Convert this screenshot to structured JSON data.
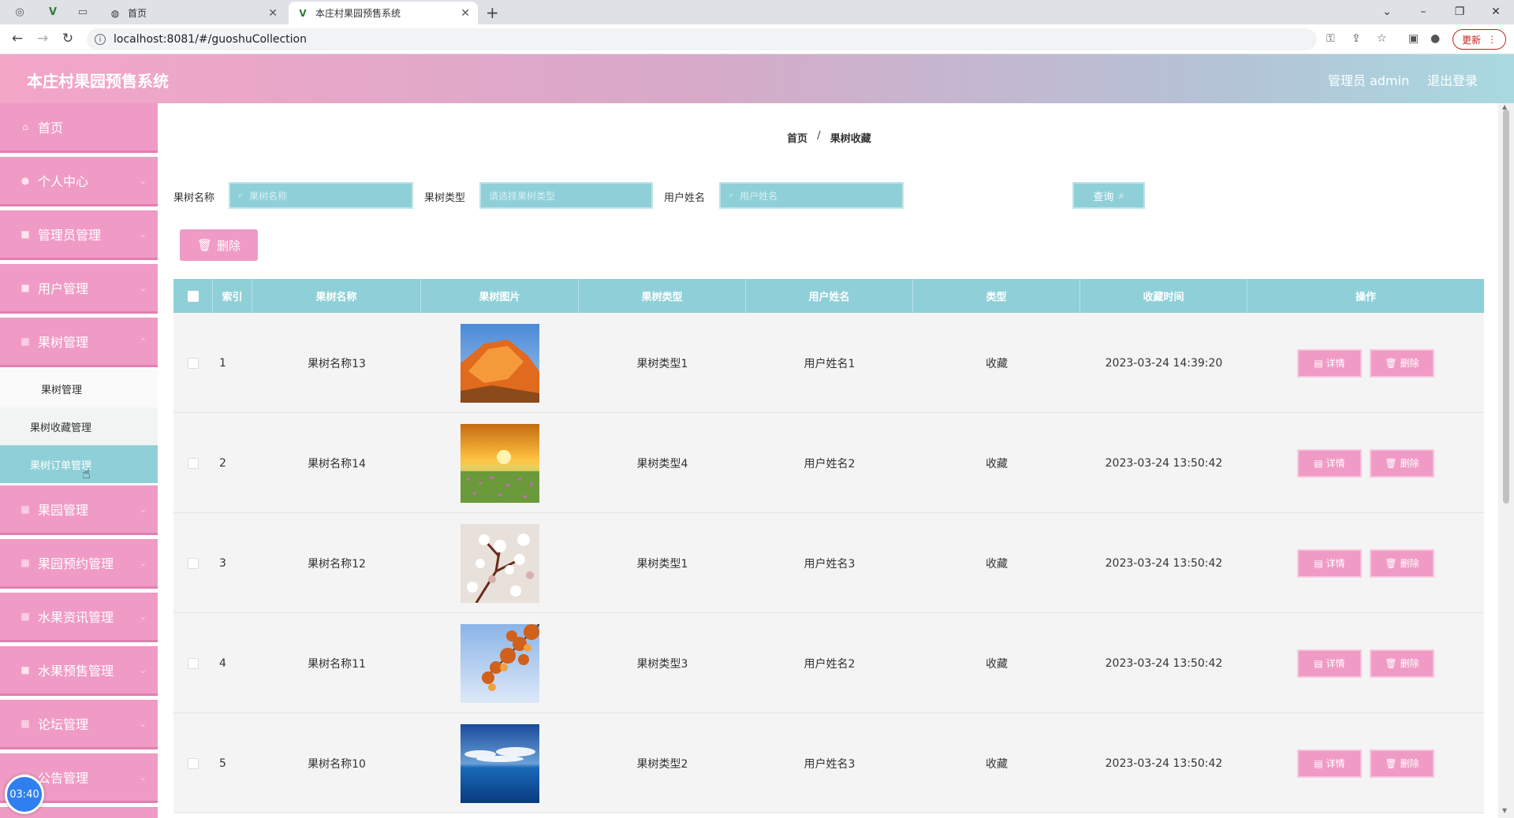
{
  "browser": {
    "tabs": [
      {
        "title": "首页"
      },
      {
        "title": "本庄村果园预售系统"
      }
    ],
    "url": "localhost:8081/#/guoshuCollection",
    "update_label": "更新"
  },
  "header": {
    "title": "本庄村果园预售系统",
    "admin_label": "管理员 admin",
    "logout_label": "退出登录"
  },
  "sidebar": {
    "items": [
      {
        "label": "首页"
      },
      {
        "label": "个人中心"
      },
      {
        "label": "管理员管理"
      },
      {
        "label": "用户管理"
      },
      {
        "label": "果树管理"
      },
      {
        "label": "果园管理"
      },
      {
        "label": "果园预约管理"
      },
      {
        "label": "水果资讯管理"
      },
      {
        "label": "水果预售管理"
      },
      {
        "label": "论坛管理"
      },
      {
        "label": "公告管理"
      }
    ],
    "submenu": [
      {
        "label": "果树管理"
      },
      {
        "label": "果树收藏管理"
      },
      {
        "label": "果树订单管理"
      }
    ],
    "timer": "03:40"
  },
  "breadcrumb": {
    "home": "首页",
    "sep": "/",
    "current": "果树收藏"
  },
  "search": {
    "name_label": "果树名称",
    "name_placeholder": "果树名称",
    "type_label": "果树类型",
    "type_placeholder": "请选择果树类型",
    "user_label": "用户姓名",
    "user_placeholder": "用户姓名",
    "query_label": "查询"
  },
  "toolbar": {
    "delete_label": "删除"
  },
  "table": {
    "columns": [
      "索引",
      "果树名称",
      "果树图片",
      "果树类型",
      "用户姓名",
      "类型",
      "收藏时间",
      "操作"
    ],
    "detail_label": "详情",
    "delete_label": "删除",
    "rows": [
      {
        "index": "1",
        "name": "果树名称13",
        "image": "orange-rock",
        "type": "果树类型1",
        "user": "用户姓名1",
        "kind": "收藏",
        "time": "2023-03-24 14:39:20"
      },
      {
        "index": "2",
        "name": "果树名称14",
        "image": "sunset-field",
        "type": "果树类型4",
        "user": "用户姓名2",
        "kind": "收藏",
        "time": "2023-03-24 13:50:42"
      },
      {
        "index": "3",
        "name": "果树名称12",
        "image": "blossom-branch",
        "type": "果树类型1",
        "user": "用户姓名3",
        "kind": "收藏",
        "time": "2023-03-24 13:50:42"
      },
      {
        "index": "4",
        "name": "果树名称11",
        "image": "autumn-leaves",
        "type": "果树类型3",
        "user": "用户姓名2",
        "kind": "收藏",
        "time": "2023-03-24 13:50:42"
      },
      {
        "index": "5",
        "name": "果树名称10",
        "image": "ocean-sky",
        "type": "果树类型2",
        "user": "用户姓名3",
        "kind": "收藏",
        "time": "2023-03-24 13:50:42"
      }
    ]
  },
  "colors": {
    "pink": "#f09bc5",
    "teal": "#8fd0d8"
  }
}
